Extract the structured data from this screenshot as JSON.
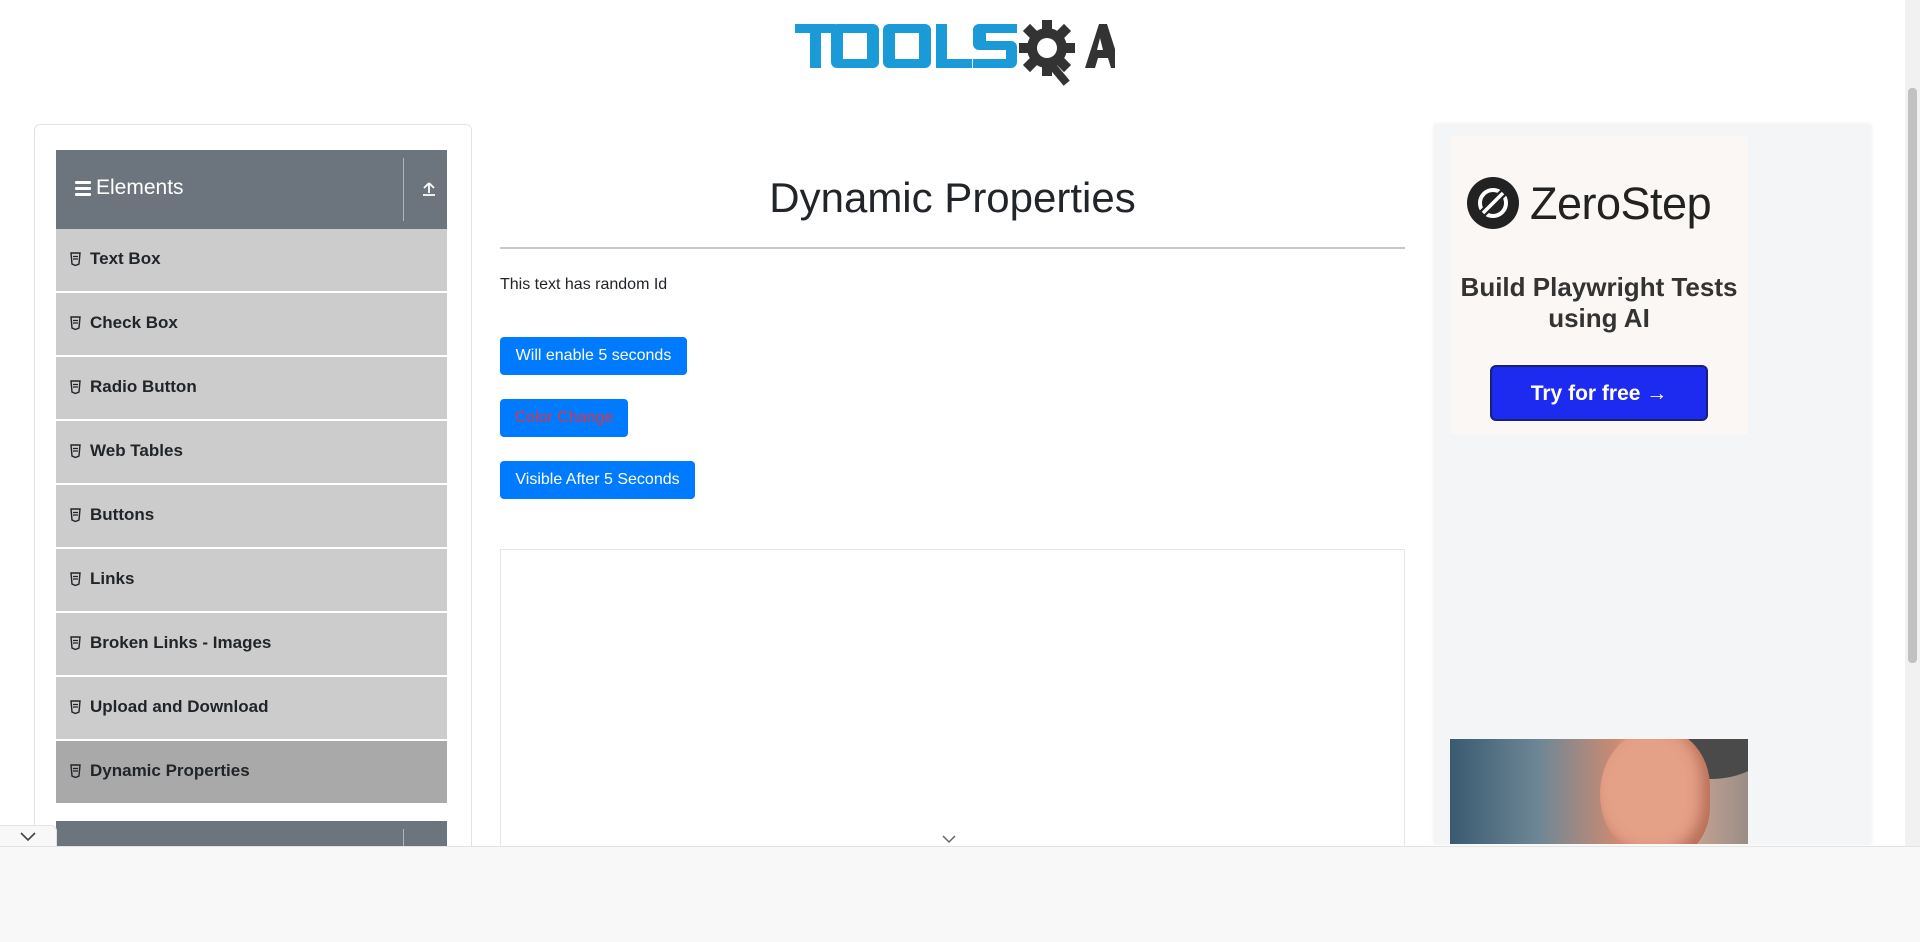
{
  "header": {
    "logo_text": "TOOLSQA",
    "brand_color": "#1a9bd7"
  },
  "sidebar": {
    "group_title": "Elements",
    "items": [
      {
        "label": "Text Box"
      },
      {
        "label": "Check Box"
      },
      {
        "label": "Radio Button"
      },
      {
        "label": "Web Tables"
      },
      {
        "label": "Buttons"
      },
      {
        "label": "Links"
      },
      {
        "label": "Broken Links - Images"
      },
      {
        "label": "Upload and Download"
      },
      {
        "label": "Dynamic Properties",
        "active": true
      }
    ],
    "header_bg": "#6c757d",
    "item_bg": "#cccccc",
    "active_bg": "#a9a9a9"
  },
  "main": {
    "title": "Dynamic Properties",
    "random_text": "This text has random Id",
    "buttons": {
      "enable": "Will enable 5 seconds",
      "color_change": "Color Change",
      "visible": "Visible After 5 Seconds"
    },
    "button_color": "#007bff",
    "color_change_text_color": "#dc3545"
  },
  "ad": {
    "brand": "ZeroStep",
    "tagline": "Build Playwright Tests using AI",
    "cta": "Try for free →",
    "cta_color": "#1d2bf0"
  }
}
